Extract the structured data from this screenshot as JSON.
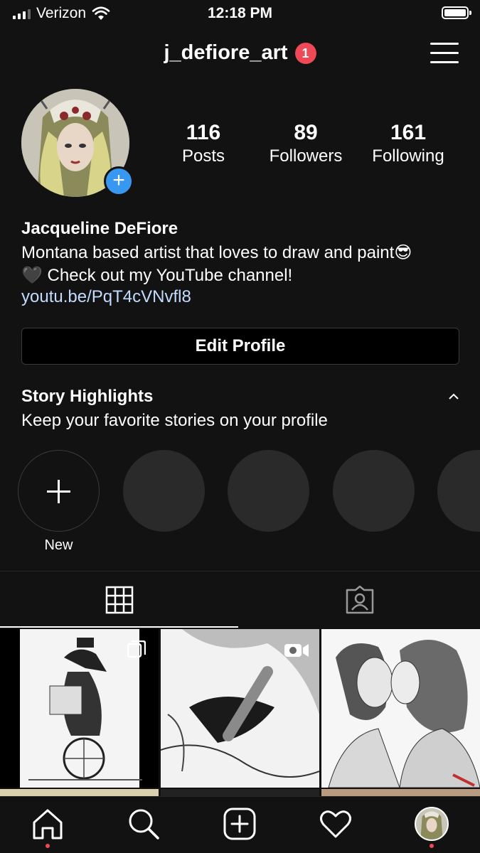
{
  "status_bar": {
    "carrier": "Verizon",
    "time": "12:18 PM"
  },
  "header": {
    "username": "j_defiore_art",
    "notification_count": "1"
  },
  "stats": [
    {
      "value": "116",
      "label": "Posts"
    },
    {
      "value": "89",
      "label": "Followers"
    },
    {
      "value": "161",
      "label": "Following"
    }
  ],
  "profile": {
    "full_name": "Jacqueline DeFiore",
    "bio_line1": "Montana based artist that loves to draw and paint😎",
    "bio_line2": "🖤 Check out my YouTube channel!",
    "link": "youtu.be/PqT4cVNvfl8",
    "edit_button": "Edit Profile"
  },
  "highlights": {
    "title": "Story Highlights",
    "subtitle": "Keep your favorite stories on your profile",
    "new_label": "New"
  },
  "tabs": [
    {
      "icon": "grid-icon"
    },
    {
      "icon": "tagged-user-icon"
    }
  ],
  "grid_posts": [
    {
      "kind": "drawing-plague-doctor-unicycle",
      "overlay_icon": "carousel-icon"
    },
    {
      "kind": "drawing-in-progress-pen",
      "overlay_icon": "video-icon"
    },
    {
      "kind": "drawing-couple-kissing",
      "overlay_icon": ""
    }
  ],
  "nav": [
    "home-icon",
    "search-icon",
    "new-post-icon",
    "activity-heart-icon",
    "profile-avatar"
  ],
  "colors": {
    "background": "#121212",
    "badge": "#ed4956",
    "link": "#c2dbff",
    "add_story": "#3897f0"
  }
}
